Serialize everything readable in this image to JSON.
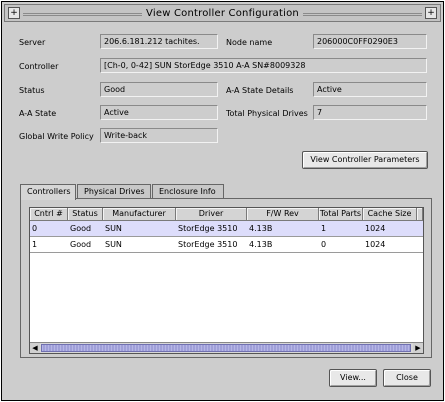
{
  "window": {
    "title": "View Controller Configuration",
    "left_button": "+",
    "right_button": "+"
  },
  "fields": {
    "server": {
      "label": "Server",
      "value": "206.6.181.212 tachites."
    },
    "node_name": {
      "label": "Node name",
      "value": "206000C0FF0290E3"
    },
    "controller": {
      "label": "Controller",
      "value": "[Ch-0, 0-42] SUN StorEdge 3510 A-A SN#8009328"
    },
    "status": {
      "label": "Status",
      "value": "Good"
    },
    "aa_state_details": {
      "label": "A-A State Details",
      "value": "Active"
    },
    "aa_state": {
      "label": "A-A State",
      "value": "Active"
    },
    "total_physical_drives": {
      "label": "Total Physical Drives",
      "value": "7"
    },
    "global_write_policy": {
      "label": "Global Write Policy",
      "value": "Write-back"
    }
  },
  "buttons": {
    "view_params": "View Controller Parameters",
    "view": "View...",
    "close": "Close"
  },
  "tabs": [
    "Controllers",
    "Physical Drives",
    "Enclosure Info"
  ],
  "table": {
    "columns": [
      "Cntrl #",
      "Status",
      "Manufacturer",
      "Driver",
      "F/W Rev",
      "Total Parts",
      "Cache Size"
    ],
    "rows": [
      [
        "0",
        "Good",
        "SUN",
        "StorEdge 3510",
        "4.13B",
        "1",
        "1024"
      ],
      [
        "1",
        "Good",
        "SUN",
        "StorEdge 3510",
        "4.13B",
        "0",
        "1024"
      ]
    ]
  },
  "scrollbar": {
    "left_arrow": "◀",
    "right_arrow": "▶"
  },
  "colors": {
    "selected_row": "#ddddfb",
    "scroll_thumb": "#9f9fd8",
    "window_bg": "#cdcdcd"
  }
}
